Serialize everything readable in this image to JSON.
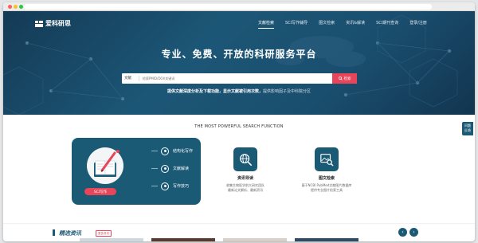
{
  "brand": {
    "name": "爱科研思"
  },
  "nav": {
    "items": [
      {
        "label": "文献检索",
        "active": true
      },
      {
        "label": "SCI写作辅导",
        "active": false
      },
      {
        "label": "图文检索",
        "active": false
      },
      {
        "label": "资讯&解读",
        "active": false
      },
      {
        "label": "SCI期刊查询",
        "active": false
      },
      {
        "label": "登录/注册",
        "active": false
      }
    ]
  },
  "hero": {
    "title": "专业、免费、开放的科研服务平台",
    "search": {
      "select_label": "文献",
      "placeholder": "检索PMID/DOI/关键词",
      "button_label": "检索"
    },
    "subtitle_bold": "提供文献深度分析及下载功能，显示文献被引用次数，",
    "subtitle_light": "提供影响因子及中科院分区"
  },
  "section": {
    "title": "THE MOST POWERFUL SEARCH FUNCTION"
  },
  "main_card": {
    "items": [
      {
        "label": "结构化写作"
      },
      {
        "label": "文献解读"
      },
      {
        "label": "写作技巧"
      }
    ],
    "button_label": "SCI写作"
  },
  "features": [
    {
      "title": "资讯导读",
      "desc_lines": [
        "收集生物医学前大研究团队",
        "最新论文解析、最新资讯"
      ]
    },
    {
      "title": "图文检索",
      "desc_lines": [
        "基于NCBI PubMed文献图片数据库",
        "提供专业图片检索工具"
      ]
    }
  ],
  "float_tab": {
    "line1": "问题",
    "line2": "反馈"
  },
  "news": {
    "title": "精选资讯",
    "more_label": "更多资讯"
  },
  "colors": {
    "primary": "#1b5a75",
    "accent": "#e8455a",
    "hero_dark": "#143a55"
  }
}
